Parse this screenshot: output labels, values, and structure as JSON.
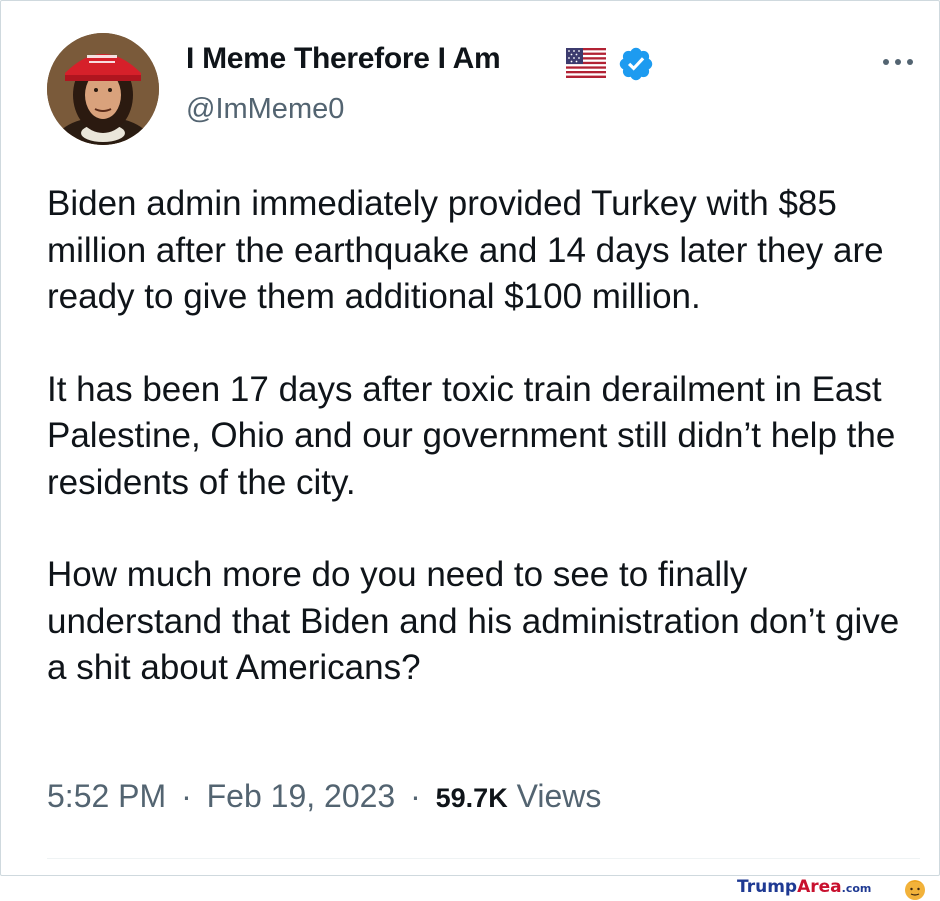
{
  "tweet": {
    "author": {
      "display_name": "I Meme Therefore I Am",
      "handle": "@ImMeme0",
      "verified": true,
      "flag_icon": "us-flag-icon",
      "avatar_icon": "avatar-icon"
    },
    "paragraphs": [
      "Biden admin immediately provided Turkey with $85 million after the earthquake and 14 days later they are ready to give them additional $100 million.",
      "It has been 17 days after toxic train derailment in East Palestine, Ohio and our government still didn’t help the residents of the city.",
      "How much more do you need to see to finally understand that Biden and his administration don’t give a shit about Americans?"
    ],
    "time": "5:52 PM",
    "date": "Feb 19, 2023",
    "separator": "·",
    "views_count": "59.7K",
    "views_label": "Views"
  },
  "watermark": {
    "brand_part1": "Trump",
    "brand_part2": "Area",
    "brand_suffix": ".com"
  },
  "colors": {
    "text_primary": "#0f1419",
    "text_secondary": "#536471",
    "verified_blue": "#1d9bf0",
    "border": "#cfd9de"
  }
}
